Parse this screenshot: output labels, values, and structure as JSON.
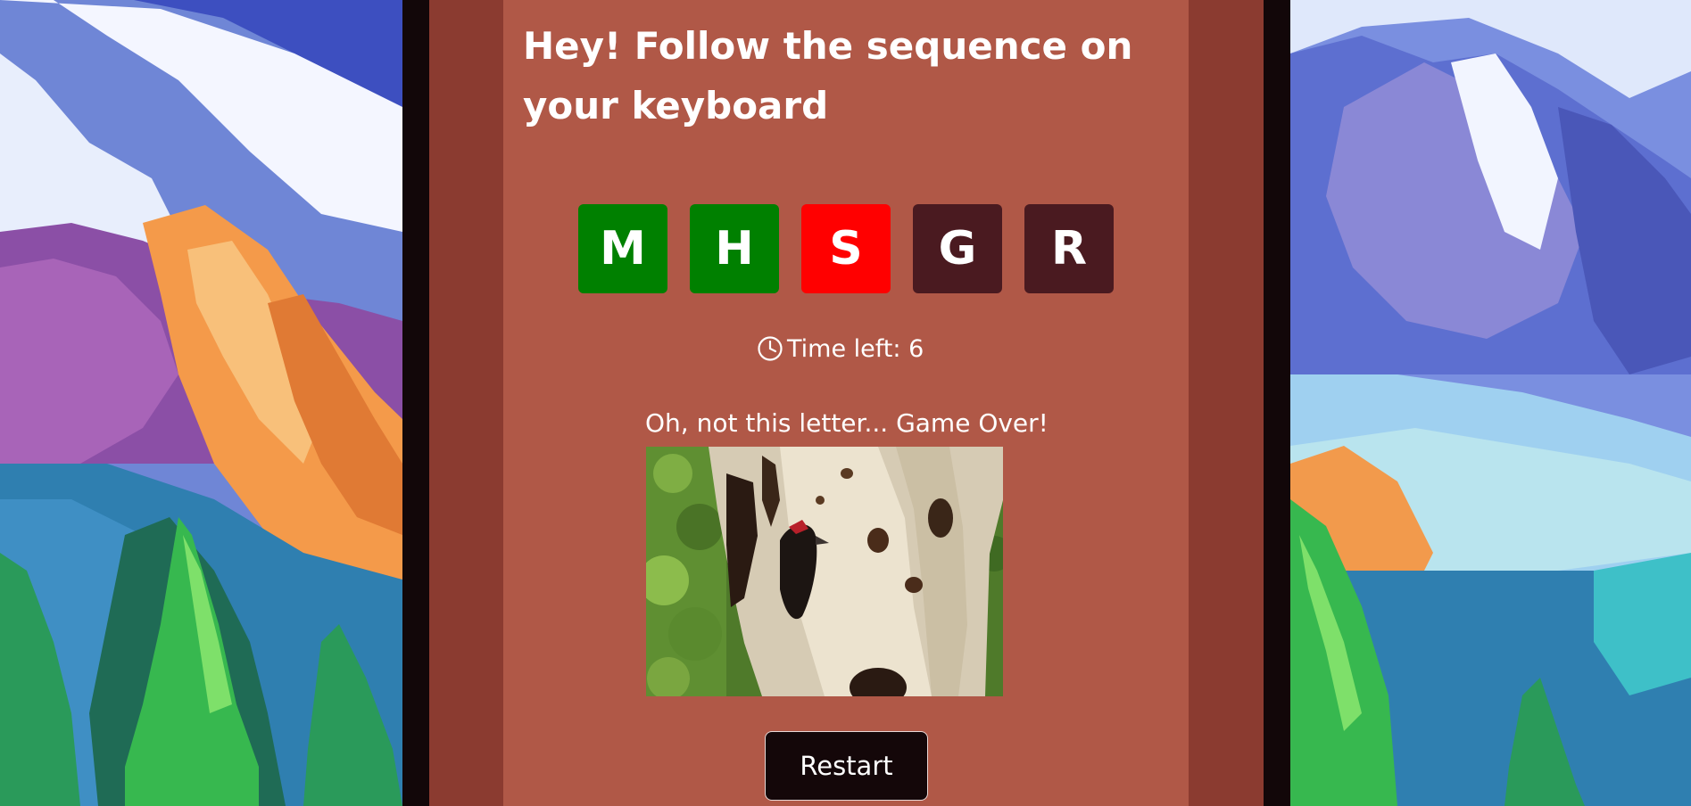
{
  "title": "Hey! Follow the sequence on your keyboard",
  "sequence": [
    {
      "letter": "M",
      "state": "correct",
      "color": "#008000"
    },
    {
      "letter": "H",
      "state": "correct",
      "color": "#008000"
    },
    {
      "letter": "S",
      "state": "wrong",
      "color": "#ff0000"
    },
    {
      "letter": "G",
      "state": "pending",
      "color": "#4a1a20"
    },
    {
      "letter": "R",
      "state": "pending",
      "color": "#4a1a20"
    }
  ],
  "timer": {
    "icon": "clock-icon",
    "text": "Time left: 6"
  },
  "message": "Oh, not this letter... Game Over!",
  "animation": {
    "icon": "woodpecker-on-tree-image"
  },
  "restart_label": "Restart",
  "colors": {
    "frame_outer": "#120709",
    "frame_mid": "#8b3b30",
    "panel": "#b05847",
    "button": "#140709"
  }
}
